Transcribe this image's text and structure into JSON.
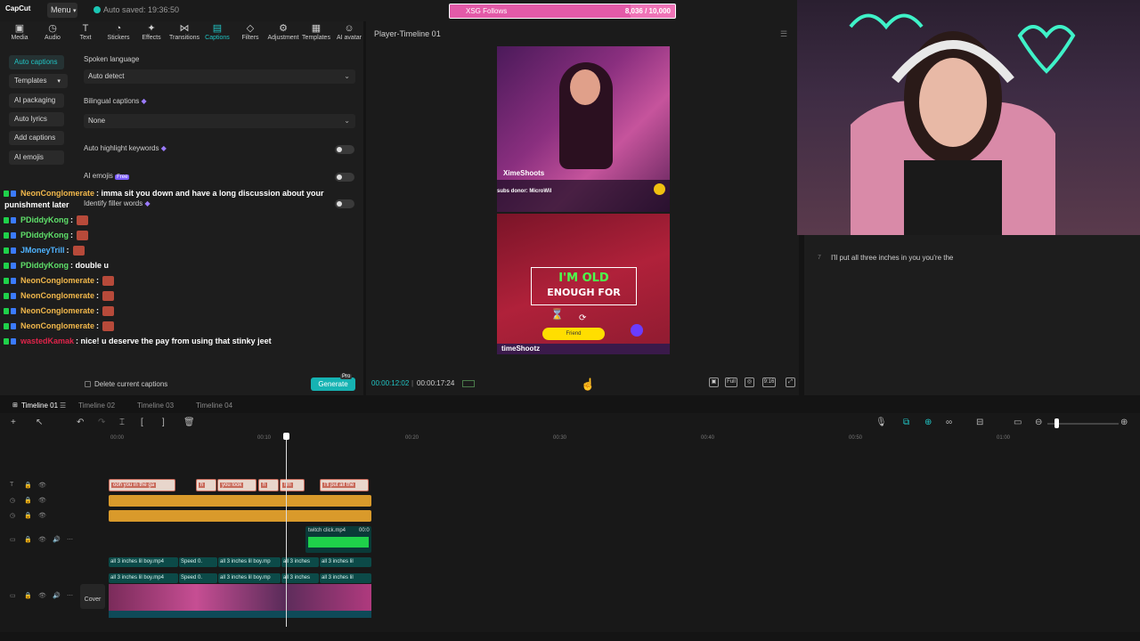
{
  "app": {
    "logo": "CapCut",
    "menu_label": "Menu",
    "autosave": "Auto saved: 19:36:50"
  },
  "overlay": {
    "follow_label": "XSG Follows",
    "follow_count": "8,036 / 10,000",
    "follow_progress": 0.8036,
    "accent": "#e35aa8"
  },
  "toolbar": {
    "tools": [
      {
        "label": "Media",
        "icon": "media-icon"
      },
      {
        "label": "Audio",
        "icon": "audio-icon"
      },
      {
        "label": "Text",
        "icon": "text-icon"
      },
      {
        "label": "Stickers",
        "icon": "stickers-icon"
      },
      {
        "label": "Effects",
        "icon": "effects-icon"
      },
      {
        "label": "Transitions",
        "icon": "transitions-icon"
      },
      {
        "label": "Captions",
        "icon": "captions-icon",
        "active": true
      },
      {
        "label": "Filters",
        "icon": "filters-icon"
      },
      {
        "label": "Adjustment",
        "icon": "adjustment-icon"
      },
      {
        "label": "Templates",
        "icon": "templates-icon"
      },
      {
        "label": "AI avatar",
        "icon": "ai-avatar-icon"
      }
    ]
  },
  "sidebar": {
    "items": [
      "Auto captions",
      "Templates",
      "AI packaging",
      "Auto lyrics",
      "Add captions",
      "AI emojis"
    ]
  },
  "captions": {
    "spoken_language_label": "Spoken language",
    "spoken_language_value": "Auto detect",
    "bilingual_label": "Bilingual captions",
    "bilingual_value": "None",
    "highlight_label": "Auto highlight keywords",
    "ai_emojis_label": "AI emojis",
    "ai_emojis_badge": "Free",
    "filler_label": "Identify filler words",
    "delete_label": "Delete current captions",
    "generate_label": "Generate",
    "pro_label": "Pro"
  },
  "chat": [
    {
      "user": "NeonConglomerate",
      "color": "#f2b84b",
      "msg": ": imma sit you down and have a long discussion about your"
    },
    {
      "user": "",
      "color": "#ffffff",
      "msg": "punishment later"
    },
    {
      "user": "PDiddyKong",
      "color": "#5fe06a",
      "msg": ":"
    },
    {
      "user": "PDiddyKong",
      "color": "#5fe06a",
      "msg": ":"
    },
    {
      "user": "JMoneyTrill",
      "color": "#4fb3ff",
      "msg": ":"
    },
    {
      "user": "PDiddyKong",
      "color": "#5fe06a",
      "msg": ": double u"
    },
    {
      "user": "NeonConglomerate",
      "color": "#f2b84b",
      "msg": ":"
    },
    {
      "user": "NeonConglomerate",
      "color": "#f2b84b",
      "msg": ":"
    },
    {
      "user": "NeonConglomerate",
      "color": "#f2b84b",
      "msg": ":"
    },
    {
      "user": "NeonConglomerate",
      "color": "#f2b84b",
      "msg": ":"
    },
    {
      "user": "wastedKamak",
      "color": "#e0244a",
      "msg": ": nice! u deserve the pay from using that stinky jeet"
    }
  ],
  "player": {
    "title": "Player-Timeline 01",
    "streamer": "XimeShoots",
    "donor": "subs donor: MicroWil",
    "caption_line1": "I'M OLD",
    "caption_line2": "ENOUGH FOR",
    "friend_label": "Friend",
    "bottom_name": "timeShootz",
    "time_current": "00:00:12:02",
    "time_total": "00:00:17:24",
    "controls": [
      "Full",
      "9:16"
    ]
  },
  "subtitle_panel": {
    "index": "7",
    "line": "I'll put all three inches in you you're the"
  },
  "timeline": {
    "tabs": [
      "Timeline 01",
      "Timeline 02",
      "Timeline 03",
      "Timeline 04"
    ],
    "ticks": [
      "00:00",
      "00:10",
      "00:20",
      "00:30",
      "00:40",
      "00:50",
      "01:00"
    ],
    "subtitle_clips": [
      "ooh you in the ga",
      "h",
      "you look",
      "h",
      "I'm",
      "I'll put all the"
    ],
    "clip_twitch": "twitch click.mp4",
    "clip_twitch_time": "00:0",
    "video_clips": [
      "all 3 inches lil boy.mp4",
      "Speed 0.",
      "all 3 inches lil boy.mp",
      "all 3 inches",
      "all 3 inches lil"
    ],
    "cover_label": "Cover"
  }
}
